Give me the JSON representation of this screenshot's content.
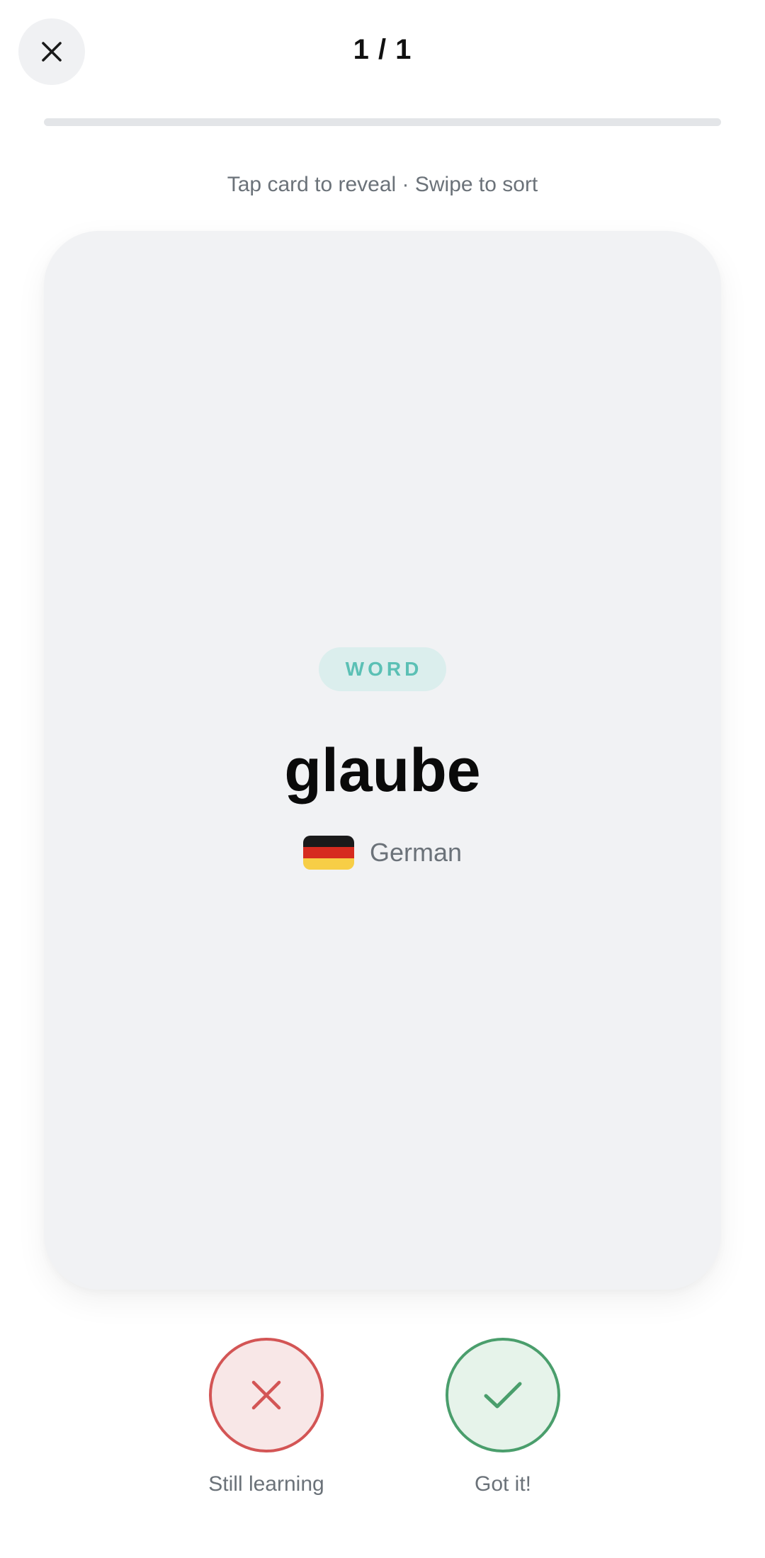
{
  "header": {
    "counter": "1 / 1",
    "close_icon": "close-icon"
  },
  "progress": {
    "value": 0,
    "track_color": "#e3e5e8"
  },
  "hint": "Tap card to reveal · Swipe to sort",
  "card": {
    "badge": "WORD",
    "word": "glaube",
    "language": "German",
    "flag_icon": "germany-flag-icon",
    "flag_colors": [
      "#1a1a1a",
      "#d62b1f",
      "#f7ce46"
    ],
    "accent": "#5bc0b5"
  },
  "actions": {
    "still_learning": {
      "label": "Still learning",
      "icon": "x-icon",
      "color": "#d35555"
    },
    "got_it": {
      "label": "Got it!",
      "icon": "checkmark-icon",
      "color": "#4a9e6c"
    }
  }
}
